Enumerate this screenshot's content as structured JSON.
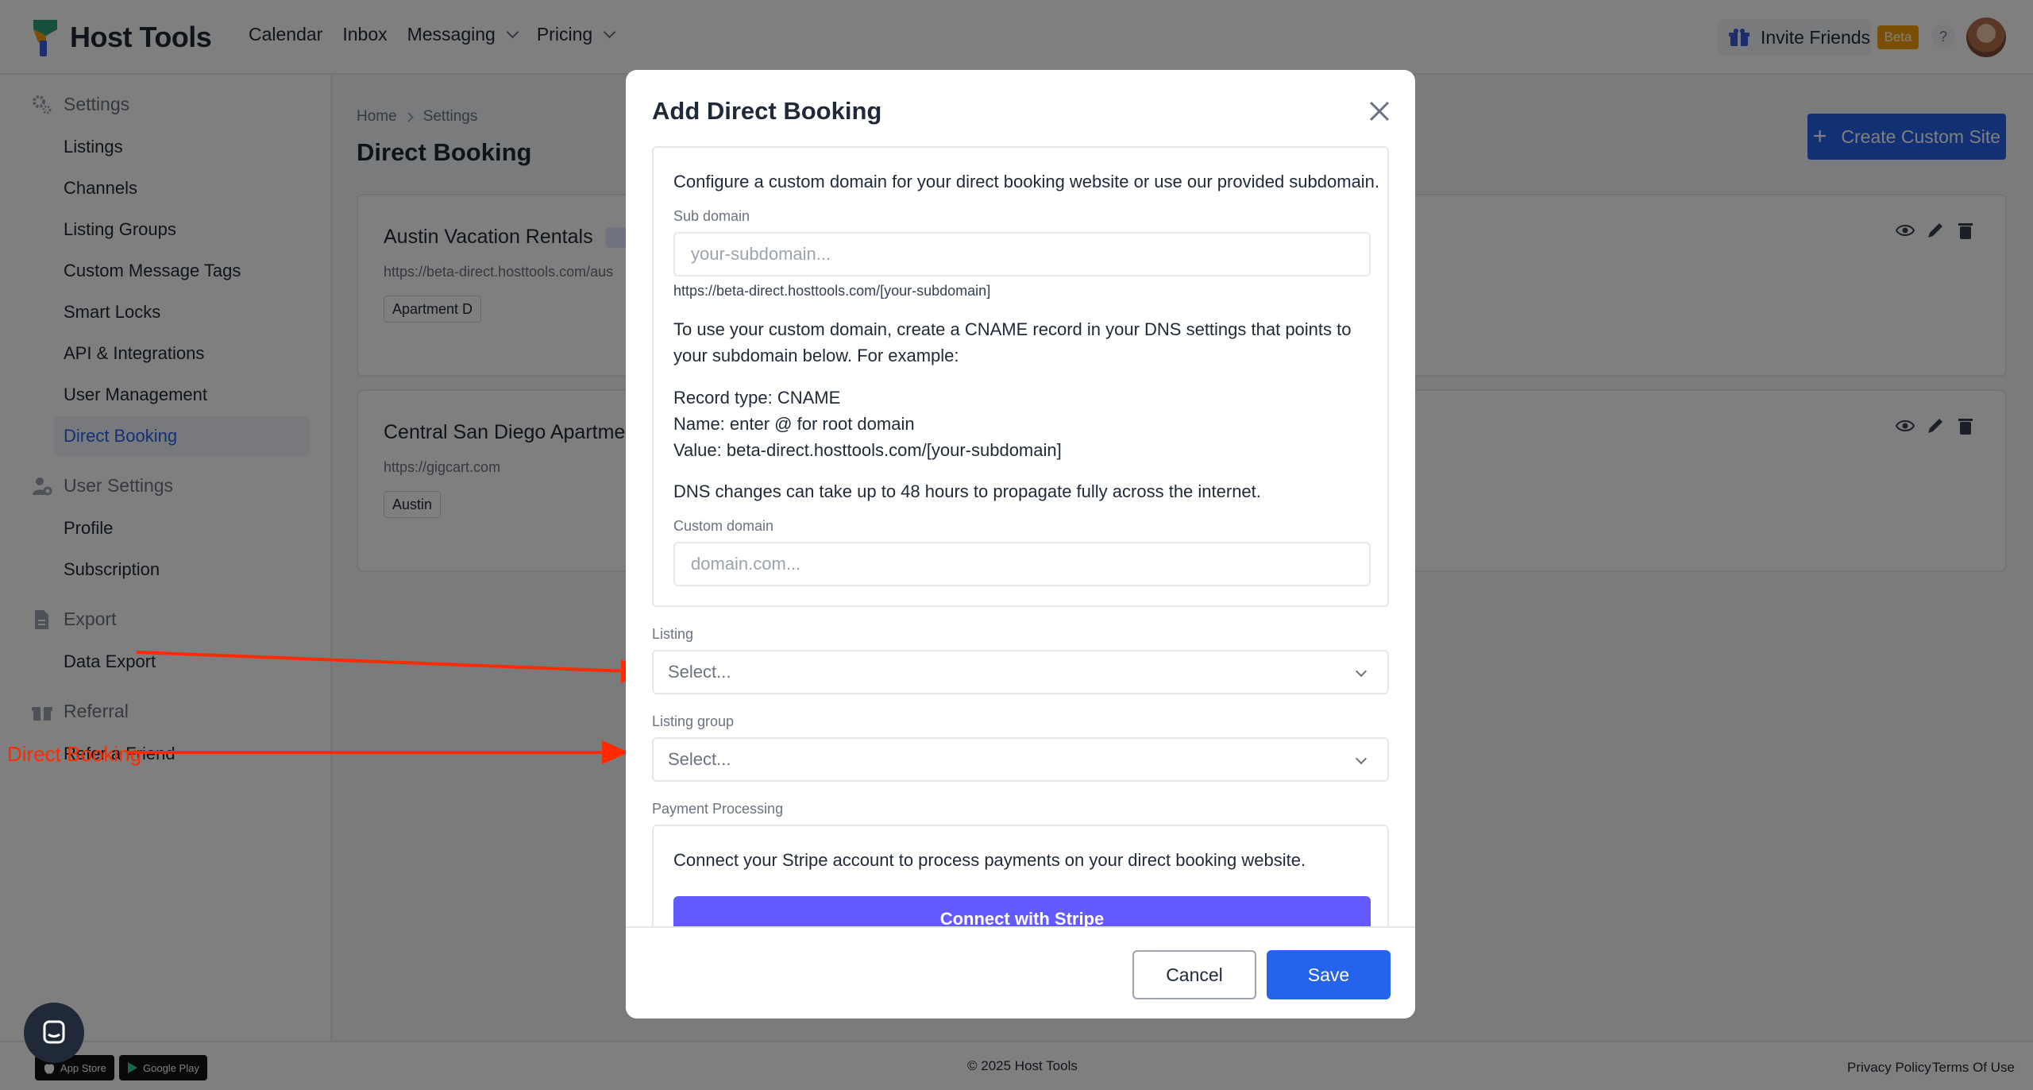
{
  "app": {
    "name": "Host Tools"
  },
  "nav": {
    "links": [
      "Calendar",
      "Inbox",
      "Messaging",
      "Pricing"
    ],
    "invite_label": "Invite Friends",
    "beta_label": "Beta",
    "help_label": "?"
  },
  "sidebar": {
    "settings_heading": "Settings",
    "settings_items": [
      "Listings",
      "Channels",
      "Listing Groups",
      "Custom Message Tags",
      "Smart Locks",
      "API & Integrations",
      "User Management",
      "Direct Booking"
    ],
    "user_heading": "User Settings",
    "user_items": [
      "Profile",
      "Subscription"
    ],
    "export_heading": "Export",
    "export_items": [
      "Data Export"
    ],
    "referral_heading": "Referral",
    "referral_items": [
      "Refer a Friend"
    ]
  },
  "main": {
    "breadcrumb": [
      "Home",
      "Settings"
    ],
    "title": "Direct Booking",
    "create_button": "Create Custom Site",
    "sites": [
      {
        "name": "Austin Vacation Rentals",
        "url": "https://beta-direct.hosttools.com/aus",
        "tag": "Apartment D"
      },
      {
        "name": "Central San Diego Apartmen",
        "url": "https://gigcart.com",
        "tag": "Austin"
      }
    ]
  },
  "modal": {
    "title": "Add Direct Booking",
    "close_label": "×",
    "intro": "Configure a custom domain for your direct booking website or use our provided subdomain.",
    "subdomain_label": "Sub domain",
    "subdomain_placeholder": "your-subdomain...",
    "subdomain_hint": "https://beta-direct.hosttools.com/[your-subdomain]",
    "cname_text": "To use your custom domain, create a CNAME record in your DNS settings that points to your subdomain below. For example:",
    "record_type": "Record type: CNAME",
    "record_name": "Name: enter @ for root domain",
    "record_value": "Value: beta-direct.hosttools.com/[your-subdomain]",
    "dns_note": "DNS changes can take up to 48 hours to propagate fully across the internet.",
    "custom_domain_label": "Custom domain",
    "custom_domain_placeholder": "domain.com...",
    "listing_label": "Listing",
    "listing_value": "Select...",
    "listing_group_label": "Listing group",
    "listing_group_value": "Select...",
    "payment_label": "Payment Processing",
    "stripe_text": "Connect your Stripe account to process payments on your direct booking website.",
    "stripe_button": "Connect with Stripe",
    "cancel_label": "Cancel",
    "save_label": "Save"
  },
  "annotation": {
    "label": "Direct Booking"
  },
  "footer": {
    "app_store": "App Store",
    "google_play": "Google Play",
    "copyright": "© 2025 Host Tools",
    "privacy": "Privacy Policy",
    "terms": "Terms Of Use"
  },
  "colors": {
    "primary": "#2563eb",
    "stripe": "#635bff",
    "beta": "#f59e0b",
    "annotation": "#ff2a00"
  }
}
